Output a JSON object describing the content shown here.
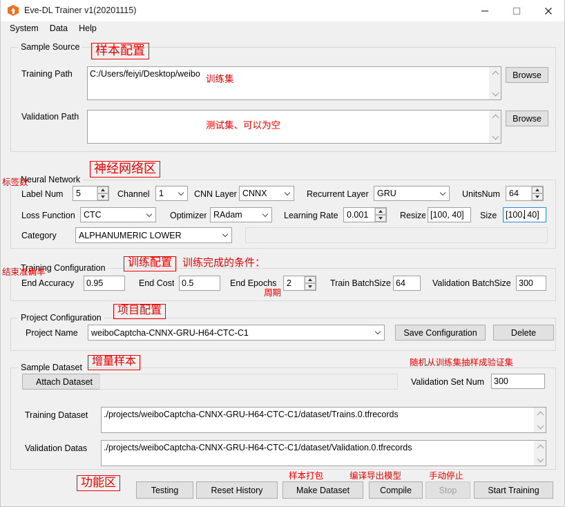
{
  "window": {
    "title": "Eve-DL Trainer v1(20201115)",
    "icon": "hexagon-upload-icon",
    "controls": {
      "minimize": "minimize-icon",
      "maximize": "maximize-icon",
      "close": "close-icon"
    }
  },
  "menubar": {
    "items": [
      "System",
      "Data",
      "Help"
    ]
  },
  "sample_source": {
    "title": "Sample Source",
    "annotation": "样本配置",
    "training_path": {
      "label": "Training Path",
      "value": "C:/Users/feiyi/Desktop/weibo",
      "annotation": "训练集",
      "browse": "Browse"
    },
    "validation_path": {
      "label": "Validation Path",
      "value": "",
      "annotation": "测试集、可以为空",
      "browse": "Browse"
    }
  },
  "neural_network": {
    "title": "Neural Network",
    "annotation": "神经网络区",
    "label_num": {
      "label": "Label Num",
      "value": "5",
      "annotation": "标签数"
    },
    "channel": {
      "label": "Channel",
      "value": "1"
    },
    "cnn_layer": {
      "label": "CNN Layer",
      "value": "CNNX"
    },
    "recurrent_layer": {
      "label": "Recurrent Layer",
      "value": "GRU"
    },
    "units_num": {
      "label": "UnitsNum",
      "value": "64"
    },
    "loss_function": {
      "label": "Loss Function",
      "value": "CTC"
    },
    "optimizer": {
      "label": "Optimizer",
      "value": "RAdam"
    },
    "learning_rate": {
      "label": "Learning Rate",
      "value": "0.001"
    },
    "resize": {
      "label": "Resize",
      "value": "[100, 40]"
    },
    "size": {
      "label": "Size",
      "value": "[100, 40]",
      "focused": true
    },
    "category": {
      "label": "Category",
      "value": "ALPHANUMERIC LOWER"
    },
    "extra_field": {
      "value": ""
    }
  },
  "training_configuration": {
    "title": "Training Configuration",
    "annotation": "训练配置",
    "annotation2": "训练完成的条件：",
    "end_accuracy": {
      "label": "End Accuracy",
      "value": "0.95",
      "annotation": "结束准确率"
    },
    "end_cost": {
      "label": "End Cost",
      "value": "0.5"
    },
    "end_epochs": {
      "label": "End Epochs",
      "value": "2",
      "annotation": "周期"
    },
    "train_batchsize": {
      "label": "Train BatchSize",
      "value": "64"
    },
    "validation_batchsize": {
      "label": "Validation BatchSize",
      "value": "300"
    }
  },
  "project_configuration": {
    "title": "Project Configuration",
    "annotation": "项目配置",
    "project_name": {
      "label": "Project Name",
      "value": "weiboCaptcha-CNNX-GRU-H64-CTC-C1"
    },
    "save_button": "Save Configuration",
    "delete_button": "Delete"
  },
  "sample_dataset": {
    "title": "Sample Dataset",
    "annotation": "增量样本",
    "attach_button": "Attach Dataset",
    "attach_field": {
      "value": ""
    },
    "validation_set_num": {
      "label": "Validation Set Num",
      "value": "300",
      "annotation": "随机从训练集抽样成验证集"
    },
    "training_dataset": {
      "label": "Training Dataset",
      "value": "./projects/weiboCaptcha-CNNX-GRU-H64-CTC-C1/dataset/Trains.0.tfrecords"
    },
    "validation_datas": {
      "label": "Validation Datas",
      "value": "./projects/weiboCaptcha-CNNX-GRU-H64-CTC-C1/dataset/Validation.0.tfrecords"
    }
  },
  "actions": {
    "annotation": "功能区",
    "buttons": [
      {
        "label": "Testing",
        "annotation": "",
        "disabled": false
      },
      {
        "label": "Reset History",
        "annotation": "",
        "disabled": false
      },
      {
        "label": "Make Dataset",
        "annotation": "样本打包",
        "disabled": false
      },
      {
        "label": "Compile",
        "annotation": "编译导出模型",
        "disabled": false
      },
      {
        "label": "Stop",
        "annotation": "手动停止",
        "disabled": true
      },
      {
        "label": "Start Training",
        "annotation": "",
        "disabled": false
      }
    ]
  },
  "colors": {
    "annotation_red": "#ee0000",
    "accent_orange": "#f2711c",
    "focus_blue": "#2e8adf"
  }
}
